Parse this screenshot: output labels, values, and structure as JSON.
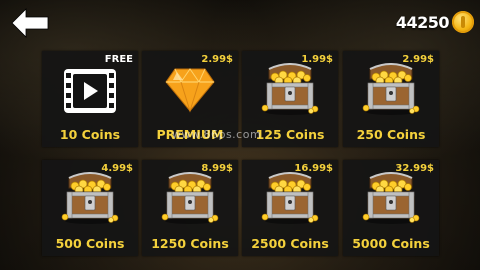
{
  "header": {
    "back_icon": "back-arrow-icon",
    "coin_balance": "44250",
    "coin_icon": "gold-coin-icon"
  },
  "products": [
    {
      "price": "FREE",
      "label": "10 Coins",
      "icon": "video-ad-icon"
    },
    {
      "price": "2.99$",
      "label": "PREMIUM",
      "icon": "diamond-gem-icon"
    },
    {
      "price": "1.99$",
      "label": "125 Coins",
      "icon": "treasure-chest-icon"
    },
    {
      "price": "2.99$",
      "label": "250 Coins",
      "icon": "treasure-chest-icon"
    },
    {
      "price": "4.99$",
      "label": "500 Coins",
      "icon": "treasure-chest-icon"
    },
    {
      "price": "8.99$",
      "label": "1250 Coins",
      "icon": "treasure-chest-icon"
    },
    {
      "price": "16.99$",
      "label": "2500 Coins",
      "icon": "treasure-chest-icon"
    },
    {
      "price": "32.99$",
      "label": "5000 Coins",
      "icon": "treasure-chest-icon"
    }
  ],
  "watermark": "www.86ps.com",
  "colors": {
    "price": "#f4d13c",
    "label": "#f4d13c",
    "card_bg": "#141414",
    "diamond": "#f7a21b"
  }
}
